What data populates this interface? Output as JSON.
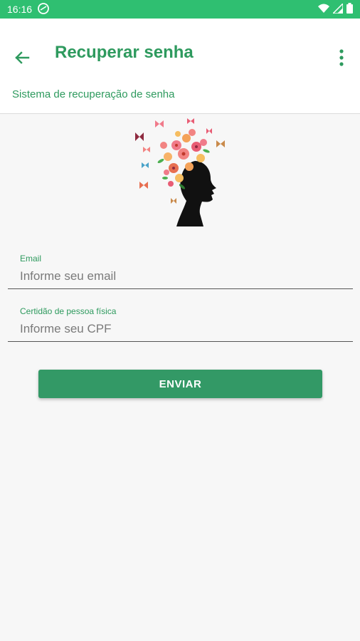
{
  "status_bar": {
    "time": "16:16"
  },
  "appbar": {
    "title": "Recuperar senha",
    "subtitle": "Sistema de recuperação de senha"
  },
  "form": {
    "email": {
      "label": "Email",
      "placeholder": "Informe seu email",
      "value": ""
    },
    "cpf": {
      "label": "Certidão de pessoa física",
      "placeholder": "Informe seu CPF",
      "value": ""
    },
    "submit_label": "ENVIAR"
  },
  "colors": {
    "status_bar": "#2fbf71",
    "accent": "#2e9a5e",
    "button": "#339966",
    "background": "#f7f7f7"
  },
  "icons": [
    "back-arrow-icon",
    "more-vert-icon",
    "wifi-icon",
    "signal-icon",
    "battery-icon",
    "sync-icon"
  ]
}
